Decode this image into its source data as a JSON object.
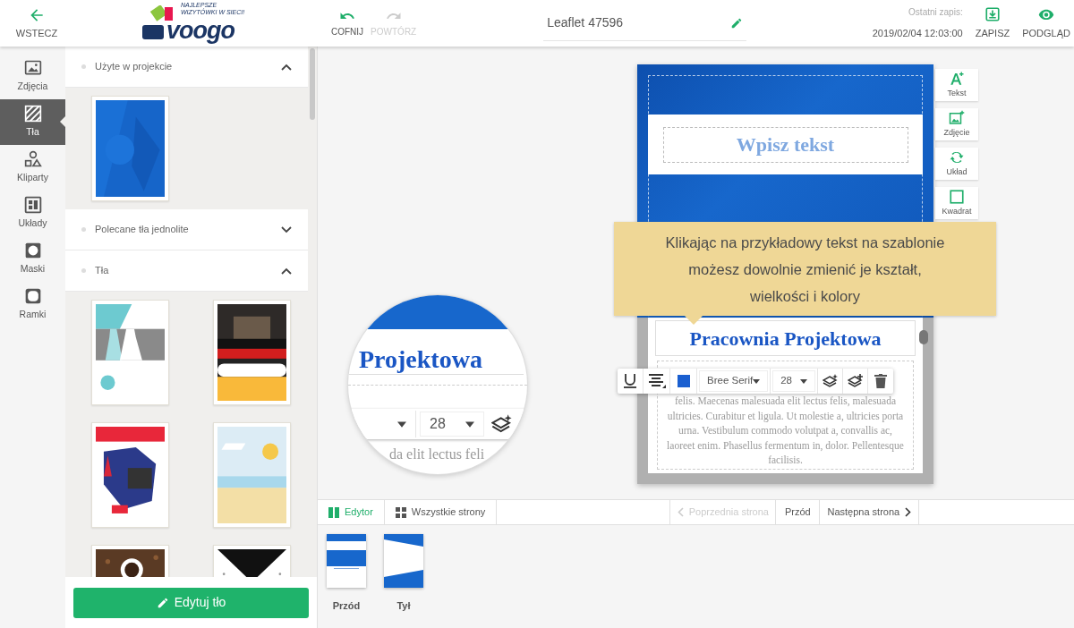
{
  "top_bar": {
    "back": "WSTECZ",
    "logo": {
      "tagline": "NAJLEPSZE WIZYTÓWKI W SIECI!",
      "name": "voogo"
    },
    "history": [
      {
        "label": "COFNIJ",
        "kind": "undo",
        "disabled": false
      },
      {
        "label": "POWTÓRZ",
        "kind": "redo",
        "disabled": true
      }
    ],
    "document_title": "Leaflet 47596",
    "last_save_label": "Ostatni zapis:",
    "last_save_time": "2019/02/04 12:03:00",
    "actions": [
      {
        "label": "ZAPISZ",
        "kind": "save"
      },
      {
        "label": "PODGLĄD",
        "kind": "preview"
      }
    ]
  },
  "rail": [
    {
      "label": "Zdjęcia",
      "selected": false
    },
    {
      "label": "Tła",
      "kind": "backgrounds",
      "selected": true
    },
    {
      "label": "Kliparty",
      "kind": "shapes",
      "selected": false
    },
    {
      "label": "Układy",
      "kind": "layouts",
      "selected": false
    },
    {
      "label": "Maski",
      "kind": "masks",
      "selected": false
    },
    {
      "label": "Ramki",
      "kind": "frames",
      "selected": false
    }
  ],
  "panel": {
    "sections": [
      {
        "title": "Użyte w projekcie",
        "expanded": true
      },
      {
        "title": "Polecane tła jednolite",
        "expanded": false
      },
      {
        "title": "Tła",
        "expanded": true
      }
    ],
    "edit_button": "Edytuj tło"
  },
  "canvas": {
    "page": {
      "heading_placeholder": "Wpisz tekst",
      "title": "Pracownia Projektowa",
      "body": "felis. Maecenas malesuada elit lectus felis, malesuada ultricies. Curabitur et ligula. Ut molestie a, ultricies porta urna. Vestibulum commodo volutpat a, convallis ac, laoreet enim. Phasellus fermentum in, dolor. Pellentesque facilisis."
    },
    "tools": [
      {
        "label": "Tekst",
        "kind": "add-text"
      },
      {
        "label": "Zdjęcie",
        "kind": "add-photo"
      },
      {
        "label": "Układ",
        "kind": "layout"
      },
      {
        "label": "Kwadrat",
        "kind": "square"
      }
    ],
    "tooltip": "Klikając na przykładowy tekst na szablonie możesz dowolnie zmienić je kształt, wielkości i kolory",
    "text_toolbar": {
      "color": "#1a5fd0",
      "font": "Bree Serif",
      "size": "28"
    },
    "magnifier": {
      "title": "Projektowa",
      "size": "28",
      "body": "da elit lectus feli"
    }
  },
  "bottom_tabs": [
    {
      "label": "Edytor",
      "kind": "editor",
      "selected": true
    },
    {
      "label": "Wszystkie strony",
      "kind": "grid",
      "selected": false
    }
  ],
  "pager": {
    "previous": {
      "label": "Poprzednia strona",
      "disabled": true
    },
    "current": "Przód",
    "next": {
      "label": "Następna strona",
      "disabled": false
    }
  },
  "pages": [
    {
      "label": "Przód",
      "kind": "front"
    },
    {
      "label": "Tył",
      "kind": "back"
    }
  ]
}
